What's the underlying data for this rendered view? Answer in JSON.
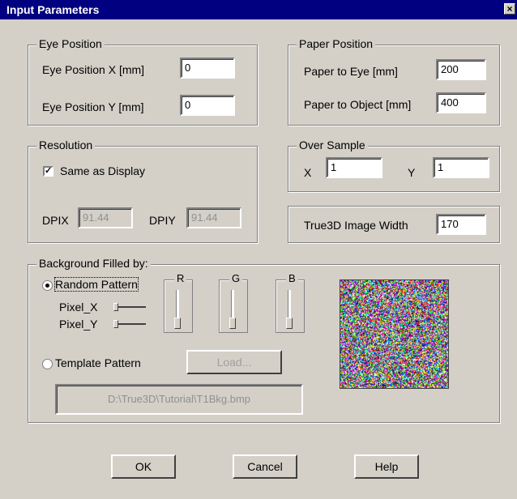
{
  "window": {
    "title": "Input Parameters",
    "close_glyph": "×"
  },
  "eye_position": {
    "legend": "Eye Position",
    "x_label": "Eye Position X [mm]",
    "x_value": "0",
    "y_label": "Eye Position Y [mm]",
    "y_value": "0"
  },
  "paper_position": {
    "legend": "Paper Position",
    "eye_label": "Paper to Eye [mm]",
    "eye_value": "200",
    "object_label": "Paper to Object [mm]",
    "object_value": "400"
  },
  "resolution": {
    "legend": "Resolution",
    "same_as_display_label": "Same as Display",
    "same_as_display_checked": true,
    "dpix_label": "DPIX",
    "dpix_value": "91.44",
    "dpiy_label": "DPIY",
    "dpiy_value": "91.44"
  },
  "over_sample": {
    "legend": "Over Sample",
    "x_label": "X",
    "x_value": "1",
    "y_label": "Y",
    "y_value": "1"
  },
  "image_width": {
    "label": "True3D Image Width",
    "value": "170"
  },
  "background": {
    "legend": "Background Filled by:",
    "random_label": "Random Pattern",
    "random_selected": true,
    "pixel_x_label": "Pixel_X",
    "pixel_y_label": "Pixel_Y",
    "r_label": "R",
    "g_label": "G",
    "b_label": "B",
    "template_label": "Template Pattern",
    "template_selected": false,
    "load_label": "Load...",
    "template_path": "D:\\True3D\\Tutorial\\T1Bkg.bmp"
  },
  "buttons": {
    "ok": "OK",
    "cancel": "Cancel",
    "help": "Help"
  },
  "icons": {
    "close": "close-icon",
    "check": "check-icon"
  }
}
